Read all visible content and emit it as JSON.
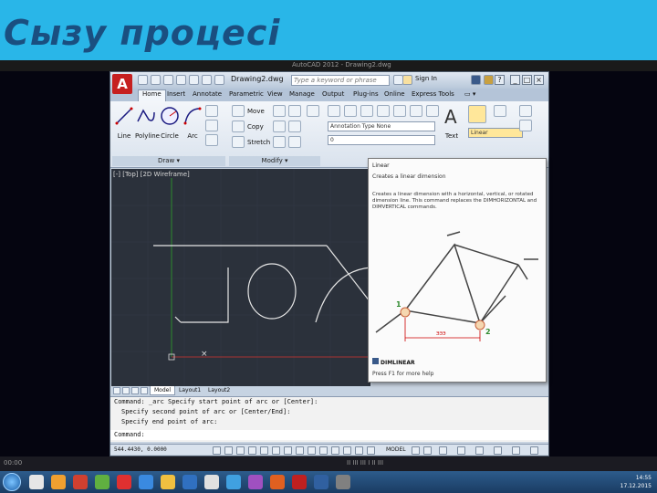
{
  "slide": {
    "title": "Сызу процесі"
  },
  "host": {
    "top_caption": "AutoCAD 2012 - Drawing2.dwg",
    "bottom_label_left": "00:00",
    "bottom_label_center": "II III III I II III"
  },
  "titlebar": {
    "logo": "A",
    "doc_title": "Drawing2.dwg",
    "search_placeholder": "Type a keyword or phrase",
    "signin": "Sign In",
    "help": "?"
  },
  "tabs": [
    "Home",
    "Insert",
    "Annotate",
    "Parametric",
    "View",
    "Manage",
    "Output",
    "Plug-ins",
    "Online",
    "Express Tools"
  ],
  "ribbon": {
    "draw": {
      "title": "Draw ▾",
      "tools": [
        "Line",
        "Polyline",
        "Circle",
        "Arc"
      ]
    },
    "modify": {
      "title": "Modify ▾",
      "tools": [
        "Move",
        "Copy",
        "Stretch"
      ]
    },
    "annotation": {
      "text_label": "Text",
      "linear_label": "Linear",
      "combo1": "Annotation Type None",
      "combo2": "0"
    }
  },
  "viewport": {
    "label": "[-] [Top] [2D Wireframe]"
  },
  "tooltip": {
    "title": "Linear",
    "desc": "Creates a linear dimension",
    "body": "Creates a linear dimension with a horizontal, vertical, or rotated dimension line. This command replaces the DIMHORIZONTAL and DIMVERTICAL commands.",
    "pt1": "1",
    "pt2": "2",
    "dim": "ЭЭЭ",
    "cmd": "DIMLINEAR",
    "help": "Press F1 for more help"
  },
  "layout_tabs": [
    "Model",
    "Layout1",
    "Layout2"
  ],
  "command_history": [
    "Command: _arc Specify start point of arc or [Center]:",
    "Specify second point of arc or [Center/End]:",
    "Specify end point of arc:"
  ],
  "command_prompt": "Command:",
  "status": {
    "coords": "544.4430, 0.0000",
    "model": "MODEL"
  },
  "taskbar": {
    "time": "14:55",
    "date": "17.12.2015"
  }
}
